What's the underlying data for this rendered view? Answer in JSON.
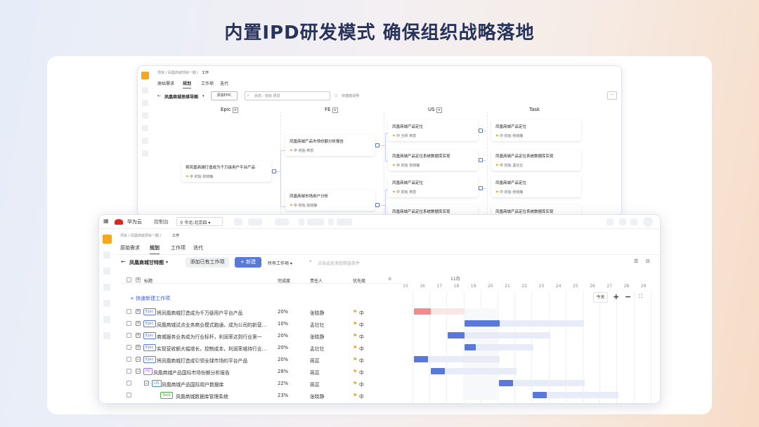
{
  "headline": "内置IPD研发模式 确保组织战略落地",
  "back": {
    "breadcrumb": "项目 / 凤凰商城项目一期 /",
    "breadcrumb_current": "工作",
    "tabs": [
      "原始需求",
      "规划",
      "工作项",
      "迭代"
    ],
    "view_title": "凤凰商城思维导图",
    "add_button": "添加EPIC",
    "filter_text": "状态：初始 研发",
    "shortcut": "快捷键说明",
    "columns": [
      "Epic",
      "FE",
      "US",
      "Task"
    ],
    "epic_node": {
      "title": "将凤凰商城打造成为千万级用户平台产品",
      "meta": "中    初始    张晓静"
    },
    "fe_nodes": [
      {
        "title": "凤凰商城产品市场份额分析报告",
        "meta": "中    初始    蒋蕊"
      },
      {
        "title": "凤凰商城市场用户分析",
        "meta": "中    初始    张晓静"
      }
    ],
    "us_nodes": [
      {
        "title": "凤凰商城产品定位",
        "meta": "中    分析    蒋蕊"
      },
      {
        "title": "凤凰商城产品定位系统数据库实现",
        "meta": "中    初始    张晓静"
      },
      {
        "title": "凤凰商城产品定位",
        "meta": "中    初始    蒋蕊"
      },
      {
        "title": "凤凰商城产品定位系统数据库实现",
        "meta": ""
      }
    ],
    "task_nodes": [
      {
        "title": "凤凰商城产品定位",
        "meta": "中    初始    张晓静"
      },
      {
        "title": "凤凰商城产品定位系统数据库实现",
        "meta": "中    初始    孟壮壮"
      },
      {
        "title": "凤凰商城产品定位",
        "meta": "中    初始    张晓静"
      },
      {
        "title": "凤凰商城产品定位系统数据库实现",
        "meta": ""
      }
    ]
  },
  "front": {
    "brand": "华为云",
    "console": "控制台",
    "region": "华北-北京四",
    "breadcrumb": "项目 / 凤凰商城项目一期 /",
    "breadcrumb_current": "工作",
    "tabs": [
      "原始需求",
      "规划",
      "工作项",
      "迭代"
    ],
    "view_title": "凤凰商城甘特图",
    "add_existing": "添加已有工作项",
    "new_button": "+ 新建",
    "all_items": "所有工作项",
    "filter_placeholder": "点击此处添加筛选条件",
    "headers": {
      "title": "标题",
      "progress": "完成度",
      "owner": "责任人",
      "priority": "优先级"
    },
    "quick_add": "+ 快速新建工作项",
    "month": "11月",
    "days": [
      "15",
      "16",
      "17",
      "18",
      "19",
      "20",
      "21",
      "22",
      "23",
      "24",
      "25",
      "26",
      "27",
      "28",
      "29"
    ],
    "today": "今天",
    "zoom_in": "+",
    "zoom_out": "−",
    "rows": [
      {
        "tag": "Epic",
        "title": "将凤凰商城打造成为千万级用户平台产品",
        "progress": "20%",
        "owner": "张晓静",
        "priority": "中"
      },
      {
        "tag": "Epic",
        "title": "凤凰商城试点业务商业模式跑通，成为公司的新营…",
        "progress": "10%",
        "owner": "孟壮壮",
        "priority": "中"
      },
      {
        "tag": "Epic",
        "title": "商城服务业务成为行业标杆，利润率达到行业第一",
        "progress": "20%",
        "owner": "张晓静",
        "priority": "中"
      },
      {
        "tag": "Epic",
        "title": "实现营收额大幅增长，控制成本，利润率维持行业…",
        "progress": "20%",
        "owner": "孟壮壮",
        "priority": "中"
      },
      {
        "tag": "Epic",
        "title": "将凤凰商城打造成引领全球市场的平台产品",
        "progress": "20%",
        "owner": "蒋蕊",
        "priority": "中"
      },
      {
        "tag": "FE",
        "title": "凤凰商城产品国际市场份额分析报告",
        "progress": "28%",
        "owner": "蒋蕊",
        "priority": "中"
      },
      {
        "tag": "US",
        "title": "凤凰商城产品国际用户数据库",
        "progress": "22%",
        "owner": "蒋蕊",
        "priority": "中"
      },
      {
        "tag": "Task",
        "title": "凤凰商城数据库管理系统",
        "progress": "23%",
        "owner": "张晓静",
        "priority": "中"
      }
    ]
  }
}
